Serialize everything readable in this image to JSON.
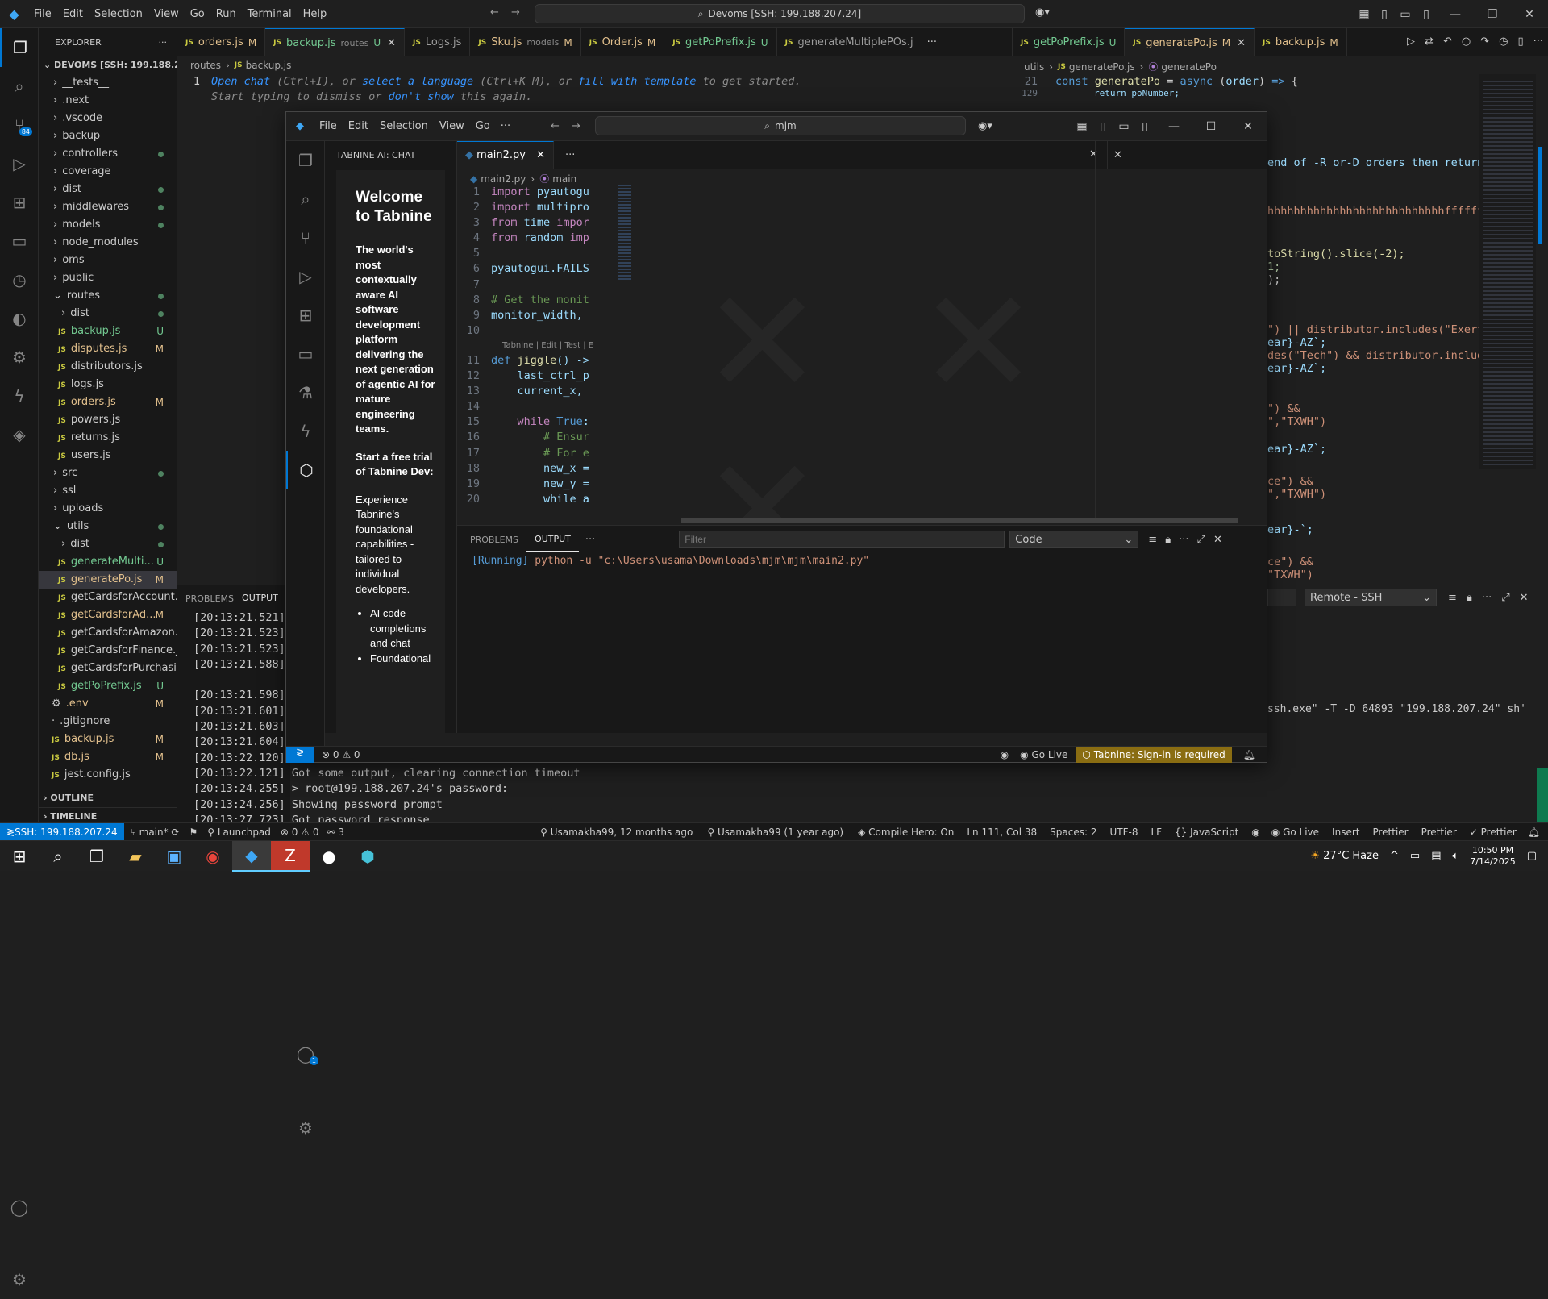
{
  "window": {
    "menu": [
      "File",
      "Edit",
      "Selection",
      "View",
      "Go",
      "Run",
      "Terminal",
      "Help"
    ],
    "command_center": "Devoms [SSH: 199.188.207.24]"
  },
  "explorer": {
    "title": "EXPLORER",
    "root": "DEVOMS [SSH: 199.188.20...",
    "items": [
      {
        "label": "__tests__",
        "kind": "folder",
        "status": ""
      },
      {
        "label": ".next",
        "kind": "folder",
        "status": ""
      },
      {
        "label": ".vscode",
        "kind": "folder",
        "status": ""
      },
      {
        "label": "backup",
        "kind": "folder",
        "status": ""
      },
      {
        "label": "controllers",
        "kind": "folder",
        "status": "dot"
      },
      {
        "label": "coverage",
        "kind": "folder",
        "status": ""
      },
      {
        "label": "dist",
        "kind": "folder",
        "status": "dot"
      },
      {
        "label": "middlewares",
        "kind": "folder",
        "status": "dot"
      },
      {
        "label": "models",
        "kind": "folder",
        "status": "dot"
      },
      {
        "label": "node_modules",
        "kind": "folder",
        "status": ""
      },
      {
        "label": "oms",
        "kind": "folder",
        "status": ""
      },
      {
        "label": "public",
        "kind": "folder",
        "status": ""
      },
      {
        "label": "routes",
        "kind": "folder-open",
        "status": "dot"
      },
      {
        "label": "dist",
        "kind": "subfolder",
        "status": "dot"
      },
      {
        "label": "backup.js",
        "kind": "js",
        "status": "U"
      },
      {
        "label": "disputes.js",
        "kind": "js",
        "status": "M"
      },
      {
        "label": "distributors.js",
        "kind": "js",
        "status": ""
      },
      {
        "label": "logs.js",
        "kind": "js",
        "status": ""
      },
      {
        "label": "orders.js",
        "kind": "js",
        "status": "M"
      },
      {
        "label": "powers.js",
        "kind": "js",
        "status": ""
      },
      {
        "label": "returns.js",
        "kind": "js",
        "status": ""
      },
      {
        "label": "users.js",
        "kind": "js",
        "status": ""
      },
      {
        "label": "src",
        "kind": "folder",
        "status": "dot"
      },
      {
        "label": "ssl",
        "kind": "folder",
        "status": ""
      },
      {
        "label": "uploads",
        "kind": "folder",
        "status": ""
      },
      {
        "label": "utils",
        "kind": "folder-open",
        "status": "dot"
      },
      {
        "label": "dist",
        "kind": "subfolder",
        "status": "dot"
      },
      {
        "label": "generateMulti...",
        "kind": "js",
        "status": "U"
      },
      {
        "label": "generatePo.js",
        "kind": "js",
        "status": "M"
      },
      {
        "label": "getCardsforAccount.js",
        "kind": "js",
        "status": ""
      },
      {
        "label": "getCardsforAd...",
        "kind": "js",
        "status": "M"
      },
      {
        "label": "getCardsforAmazon.js",
        "kind": "js",
        "status": ""
      },
      {
        "label": "getCardsforFinance.js",
        "kind": "js",
        "status": ""
      },
      {
        "label": "getCardsforPurchasi...",
        "kind": "js",
        "status": ""
      },
      {
        "label": "getPoPrefix.js",
        "kind": "js",
        "status": "U"
      },
      {
        "label": ".env",
        "kind": "gear",
        "status": "M"
      },
      {
        "label": ".gitignore",
        "kind": "file",
        "status": ""
      },
      {
        "label": "backup.js",
        "kind": "js-root",
        "status": "M"
      },
      {
        "label": "db.js",
        "kind": "js-root",
        "status": "M"
      },
      {
        "label": "jest.config.js",
        "kind": "js-root",
        "status": ""
      }
    ],
    "outline": "OUTLINE",
    "timeline": "TIMELINE"
  },
  "tabs_left": [
    {
      "label": "orders.js",
      "status": "M"
    },
    {
      "label": "backup.js",
      "sub": "routes",
      "status": "U"
    },
    {
      "label": "Logs.js",
      "status": ""
    },
    {
      "label": "Sku.js",
      "sub": "models",
      "status": "M"
    },
    {
      "label": "Order.js",
      "status": "M"
    },
    {
      "label": "getPoPrefix.js",
      "status": "U"
    },
    {
      "label": "generateMultiplePOs.j",
      "status": ""
    }
  ],
  "tabs_right": [
    {
      "label": "getPoPrefix.js",
      "status": "U"
    },
    {
      "label": "generatePo.js",
      "status": "M"
    },
    {
      "label": "backup.js",
      "status": "M"
    }
  ],
  "left_editor": {
    "breadcrumb": [
      "routes",
      "backup.js"
    ],
    "line_no": "1",
    "hint_parts": [
      {
        "t": "Open chat",
        "link": true
      },
      {
        "t": " (Ctrl+I), or ",
        "link": false
      },
      {
        "t": "select a language",
        "link": true
      },
      {
        "t": " (Ctrl+K M), or ",
        "link": false
      },
      {
        "t": "fill with template",
        "link": true
      },
      {
        "t": " to get started.",
        "link": false
      }
    ],
    "hint2_parts": [
      {
        "t": "Start typing to dismiss or ",
        "link": false
      },
      {
        "t": "don't show",
        "link": true
      },
      {
        "t": " this again.",
        "link": false
      }
    ]
  },
  "right_editor": {
    "breadcrumb": [
      "utils",
      "generatePo.js",
      "generatePo"
    ],
    "lines": [
      {
        "n": "21",
        "code": "const generatePo = async (order) => {"
      },
      {
        "n": "129",
        "code": "    return poNumber;"
      }
    ],
    "fragments": [
      "end of -R or-D orders then return",
      "hhhhhhhhhhhhhhhhhhhhhhhhhhhffffffff",
      "toString().slice(-2);",
      "1;",
      ");",
      "\") || distributor.includes(\"Exert",
      "ear}-AZ`;",
      "des(\"Tech\") && distributor.include",
      "ear}-AZ`;",
      "\") &&",
      "\",\"TXWH\")",
      "ear}-AZ`;",
      "ce\") &&",
      "\",\"TXWH\")",
      "ear}-`;",
      "ce\") &&",
      "\"TXWH\")"
    ],
    "panel_dropdown": "Remote - SSH",
    "terminal_line": "ssh.exe\" -T -D 64893 \"199.188.207.24\" sh'"
  },
  "bottom_panel": {
    "tabs": [
      "PROBLEMS",
      "OUTPUT"
    ],
    "lines": [
      "[20:13:21.521]",
      "[20:13:21.523]",
      "[20:13:21.523]",
      "[20:13:21.588]",
      "",
      "[20:13:21.598]",
      "[20:13:21.601]",
      "[20:13:21.603]",
      "[20:13:21.604]",
      "[20:13:22.120]",
      "[20:13:22.121] Got some output, clearing connection timeout",
      "[20:13:24.255] > root@199.188.207.24's password:",
      "[20:13:24.256] Showing password prompt",
      "[20:13:27.723] Got password response"
    ]
  },
  "overlay": {
    "menu": [
      "File",
      "Edit",
      "Selection",
      "View",
      "Go"
    ],
    "search": "mjm",
    "sidebar_title": "TABNINE AI: CHAT",
    "tabnine": {
      "heading": "Welcome to Tabnine",
      "lead": "The world's most contextually aware AI software development platform delivering the next generation of agentic AI for mature engineering teams.",
      "trial": "Start a free trial of Tabnine Dev:",
      "desc": "Experience Tabnine's foundational capabilities - tailored to individual developers.",
      "bullets": [
        "AI code completions and chat",
        "Foundational"
      ]
    },
    "tab": "main2.py",
    "breadcrumb": [
      "main2.py",
      "main"
    ],
    "codelens": "Tabnine | Edit | Test | E",
    "code": [
      {
        "n": "1",
        "parts": [
          [
            "kw",
            "import "
          ],
          [
            "var",
            "pyautogu"
          ]
        ]
      },
      {
        "n": "2",
        "parts": [
          [
            "kw",
            "import "
          ],
          [
            "var",
            "multipro"
          ]
        ]
      },
      {
        "n": "3",
        "parts": [
          [
            "kw",
            "from "
          ],
          [
            "var",
            "time "
          ],
          [
            "kw",
            "impor"
          ]
        ]
      },
      {
        "n": "4",
        "parts": [
          [
            "kw",
            "from "
          ],
          [
            "var",
            "random "
          ],
          [
            "kw",
            "imp"
          ]
        ]
      },
      {
        "n": "5",
        "parts": []
      },
      {
        "n": "6",
        "parts": [
          [
            "var",
            "pyautogui.FAILS"
          ]
        ]
      },
      {
        "n": "7",
        "parts": []
      },
      {
        "n": "8",
        "parts": [
          [
            "cm",
            "# Get the monit"
          ]
        ]
      },
      {
        "n": "9",
        "parts": [
          [
            "var",
            "monitor_width, "
          ]
        ]
      },
      {
        "n": "10",
        "parts": []
      },
      {
        "n": "11",
        "parts": [
          [
            "bl",
            "def "
          ],
          [
            "fn",
            "jiggle"
          ],
          [
            "var",
            "() ->"
          ]
        ]
      },
      {
        "n": "12",
        "parts": [
          [
            "var",
            "    last_ctrl_p"
          ]
        ]
      },
      {
        "n": "13",
        "parts": [
          [
            "var",
            "    current_x, "
          ]
        ]
      },
      {
        "n": "14",
        "parts": []
      },
      {
        "n": "15",
        "parts": [
          [
            "kw",
            "    while "
          ],
          [
            "bl",
            "True"
          ],
          [
            "var",
            ":"
          ]
        ]
      },
      {
        "n": "16",
        "parts": [
          [
            "cm",
            "        # Ensur"
          ]
        ]
      },
      {
        "n": "17",
        "parts": [
          [
            "cm",
            "        # For e"
          ]
        ]
      },
      {
        "n": "18",
        "parts": [
          [
            "var",
            "        new_x ="
          ]
        ]
      },
      {
        "n": "19",
        "parts": [
          [
            "var",
            "        new_y ="
          ]
        ]
      },
      {
        "n": "20",
        "parts": [
          [
            "var",
            "        while a"
          ]
        ]
      }
    ],
    "panel_tabs": [
      "PROBLEMS",
      "OUTPUT"
    ],
    "filter_placeholder": "Filter",
    "output_select": "Code",
    "output_line_a": "[Running]",
    "output_line_b": " python -u \"c:\\Users\\usama\\Downloads\\mjm\\mjm\\main2.py\"",
    "status_errors": "0",
    "status_warnings": "0",
    "golive": "Go Live",
    "tabnine_status": "Tabnine: Sign-in is required",
    "account_badge": "1"
  },
  "statusbar": {
    "remote": "SSH: 199.188.207.24",
    "branch": "main*",
    "launchpad": "Launchpad",
    "errors": "0",
    "warnings": "0",
    "ports": "3",
    "blame1": "Usamakha99, 12 months ago",
    "blame2": "Usamakha99 (1 year ago)",
    "compile": "Compile Hero: On",
    "position": "Ln 111, Col 38",
    "spaces": "Spaces: 2",
    "encoding": "UTF-8",
    "eol": "LF",
    "language": "JavaScript",
    "golive": "Go Live",
    "insert": "Insert",
    "prettier1": "Prettier",
    "prettier2": "Prettier",
    "prettier3": "Prettier"
  },
  "taskbar": {
    "weather": "27°C Haze",
    "time": "10:50 PM",
    "date": "7/14/2025"
  }
}
